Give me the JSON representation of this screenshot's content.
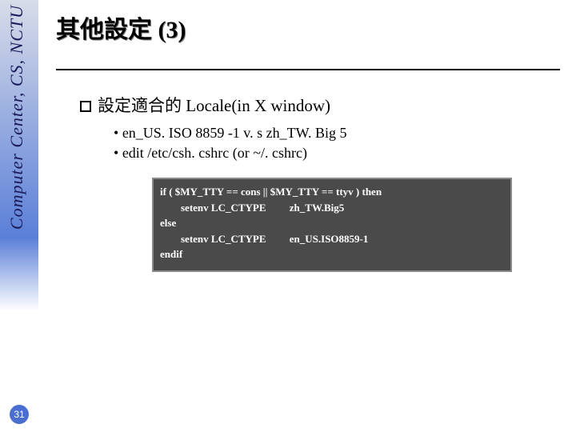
{
  "sidebar": {
    "org": "Computer Center, CS, NCTU",
    "page": "31"
  },
  "title": "其他設定 (3)",
  "section": {
    "heading": "設定適合的 Locale(in X window)",
    "bullets": [
      "en_US. ISO 8859 -1 v. s zh_TW. Big 5",
      "edit /etc/csh. cshrc (or ~/. cshrc)"
    ]
  },
  "code": {
    "l1": "if ( $MY_TTY == cons || $MY_TTY == ttyv ) then",
    "l2": "        setenv LC_CTYPE         zh_TW.Big5",
    "l3": "else",
    "l4": "        setenv LC_CTYPE         en_US.ISO8859-1",
    "l5": "endif"
  }
}
